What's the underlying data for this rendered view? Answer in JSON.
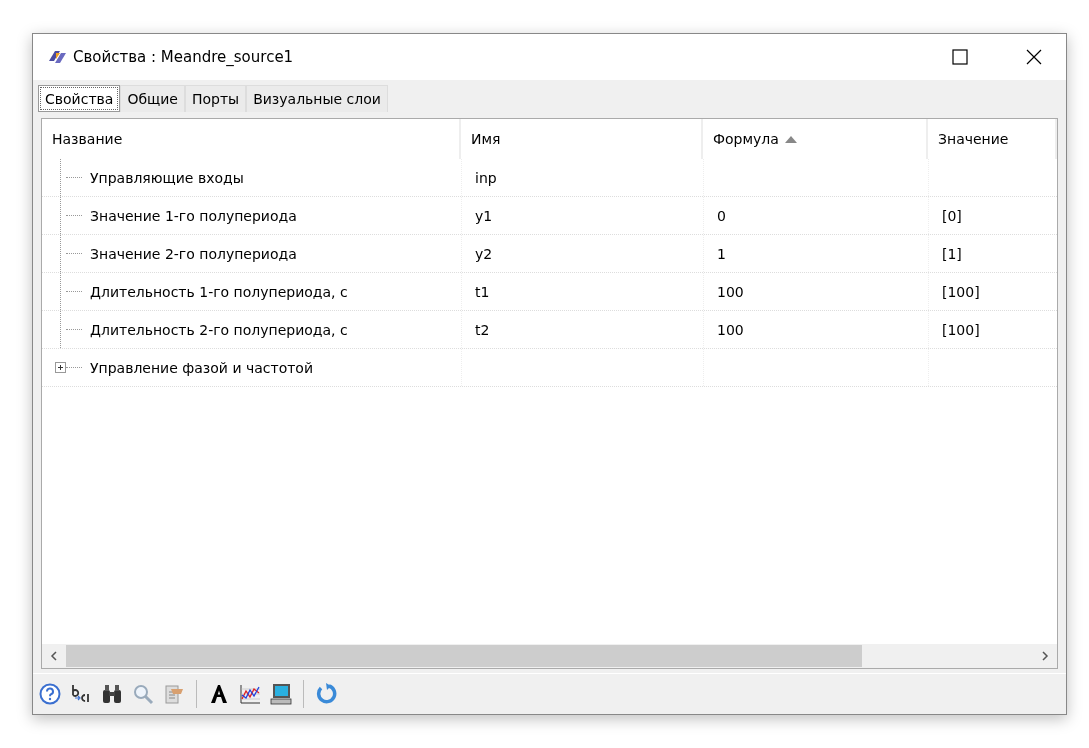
{
  "window": {
    "title": "Свойства : Meandre_source1"
  },
  "tabs": [
    {
      "label": "Свойства",
      "selected": true
    },
    {
      "label": "Общие",
      "selected": false
    },
    {
      "label": "Порты",
      "selected": false
    },
    {
      "label": "Визуальные слои",
      "selected": false
    }
  ],
  "table": {
    "columns": [
      {
        "label": "Название",
        "sorted": false
      },
      {
        "label": "Имя",
        "sorted": false
      },
      {
        "label": "Формула",
        "sorted": true
      },
      {
        "label": "Значение",
        "sorted": false
      }
    ],
    "rows": [
      {
        "kind": "leaf",
        "name": "Управляющие входы",
        "id": "inp"
      },
      {
        "kind": "leaf",
        "name": "Значение 1-го полупериода",
        "id": "y1",
        "formula": "0",
        "value": "[0]"
      },
      {
        "kind": "leaf",
        "name": "Значение 2-го полупериода",
        "id": "y2",
        "formula": "1",
        "value": "[1]"
      },
      {
        "kind": "leaf",
        "name": "Длительность 1-го полупериода, с",
        "id": "t1",
        "formula": "100",
        "value": "[100]"
      },
      {
        "kind": "leaf",
        "name": "Длительность 2-го полупериода, с",
        "id": "t2",
        "formula": "100",
        "value": "[100]"
      },
      {
        "kind": "group",
        "expanded": false,
        "name": "Управление фазой и частотой"
      }
    ]
  },
  "toolbar": [
    {
      "kind": "help"
    },
    {
      "kind": "rename"
    },
    {
      "kind": "binoculars"
    },
    {
      "kind": "magnifier"
    },
    {
      "kind": "handshake"
    },
    {
      "kind": "separator"
    },
    {
      "kind": "font"
    },
    {
      "kind": "chart"
    },
    {
      "kind": "computer"
    },
    {
      "kind": "separator"
    },
    {
      "kind": "refresh"
    }
  ]
}
